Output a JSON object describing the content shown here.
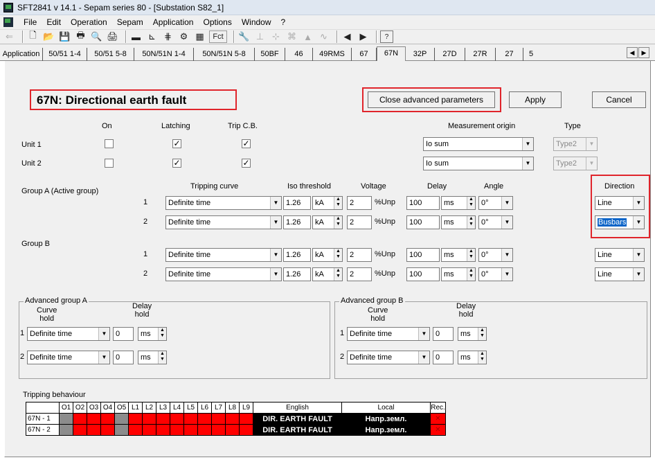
{
  "window": {
    "title": "SFT2841  v 14.1 - Sepam series 80 - [Substation S82_1]"
  },
  "menu": [
    "File",
    "Edit",
    "Operation",
    "Sepam",
    "Application",
    "Options",
    "Window",
    "?"
  ],
  "toolbar": {
    "fct_label": "Fct"
  },
  "tabs": [
    "Application",
    "50/51 1-4",
    "50/51 5-8",
    "50N/51N 1-4",
    "50N/51N 5-8",
    "50BF",
    "46",
    "49RMS",
    "67",
    "67N",
    "32P",
    "27D",
    "27R",
    "27",
    "5"
  ],
  "active_tab": "67N",
  "header": {
    "title": "67N: Directional earth fault",
    "close_adv_label": "Close advanced parameters",
    "apply_label": "Apply",
    "cancel_label": "Cancel"
  },
  "units": {
    "col_on": "On",
    "col_latching": "Latching",
    "col_trip": "Trip C.B.",
    "col_meas": "Measurement origin",
    "col_type": "Type",
    "rows": [
      {
        "label": "Unit 1",
        "on": "",
        "latching": "✓",
        "trip": "✓",
        "meas": "Io sum",
        "type": "Type2"
      },
      {
        "label": "Unit 2",
        "on": "",
        "latching": "✓",
        "trip": "✓",
        "meas": "Io sum",
        "type": "Type2"
      }
    ]
  },
  "groups": {
    "col_curve": "Tripping curve",
    "col_iso": "Iso threshold",
    "col_voltage": "Voltage",
    "col_delay": "Delay",
    "col_angle": "Angle",
    "col_direction": "Direction",
    "group_a_label": "Group A  (Active group)",
    "group_b_label": "Group B",
    "rows": [
      {
        "num": "1",
        "curve": "Definite time",
        "iso": "1.26",
        "iso_unit": "kA",
        "voltage": "2",
        "voltage_unit": "%Unp",
        "delay": "100",
        "delay_unit": "ms",
        "angle": "0°",
        "direction": "Line"
      },
      {
        "num": "2",
        "curve": "Definite time",
        "iso": "1.26",
        "iso_unit": "kA",
        "voltage": "2",
        "voltage_unit": "%Unp",
        "delay": "100",
        "delay_unit": "ms",
        "angle": "0°",
        "direction": "Busbars"
      },
      {
        "num": "1",
        "curve": "Definite time",
        "iso": "1.26",
        "iso_unit": "kA",
        "voltage": "2",
        "voltage_unit": "%Unp",
        "delay": "100",
        "delay_unit": "ms",
        "angle": "0°",
        "direction": "Line"
      },
      {
        "num": "2",
        "curve": "Definite time",
        "iso": "1.26",
        "iso_unit": "kA",
        "voltage": "2",
        "voltage_unit": "%Unp",
        "delay": "100",
        "delay_unit": "ms",
        "angle": "0°",
        "direction": "Line"
      }
    ]
  },
  "advanced": {
    "a_label": "Advanced group A",
    "b_label": "Advanced group B",
    "curve_hold": "Curve\nhold",
    "delay_hold": "Delay\nhold",
    "a_rows": [
      {
        "num": "1",
        "curve": "Definite time",
        "delay": "0",
        "unit": "ms"
      },
      {
        "num": "2",
        "curve": "Definite time",
        "delay": "0",
        "unit": "ms"
      }
    ],
    "b_rows": [
      {
        "num": "1",
        "curve": "Definite time",
        "delay": "0",
        "unit": "ms"
      },
      {
        "num": "2",
        "curve": "Definite time",
        "delay": "0",
        "unit": "ms"
      }
    ]
  },
  "tripping": {
    "label": "Tripping behaviour",
    "cols": [
      "O1",
      "O2",
      "O3",
      "O4",
      "O5",
      "L1",
      "L2",
      "L3",
      "L4",
      "L5",
      "L6",
      "L7",
      "L8",
      "L9"
    ],
    "col_english": "English",
    "col_local": "Local",
    "col_rec": "Rec.",
    "rows": [
      {
        "name": "67N - 1",
        "english": "DIR. EARTH FAULT",
        "local": "Напр.земл.",
        "rec": "✕"
      },
      {
        "name": "67N - 2",
        "english": "DIR. EARTH FAULT",
        "local": "Напр.земл.",
        "rec": "✕"
      }
    ]
  },
  "colors": {
    "highlight": "#e0242b",
    "trip_red": "#ff0000",
    "trip_gray": "#8c8c8c"
  }
}
